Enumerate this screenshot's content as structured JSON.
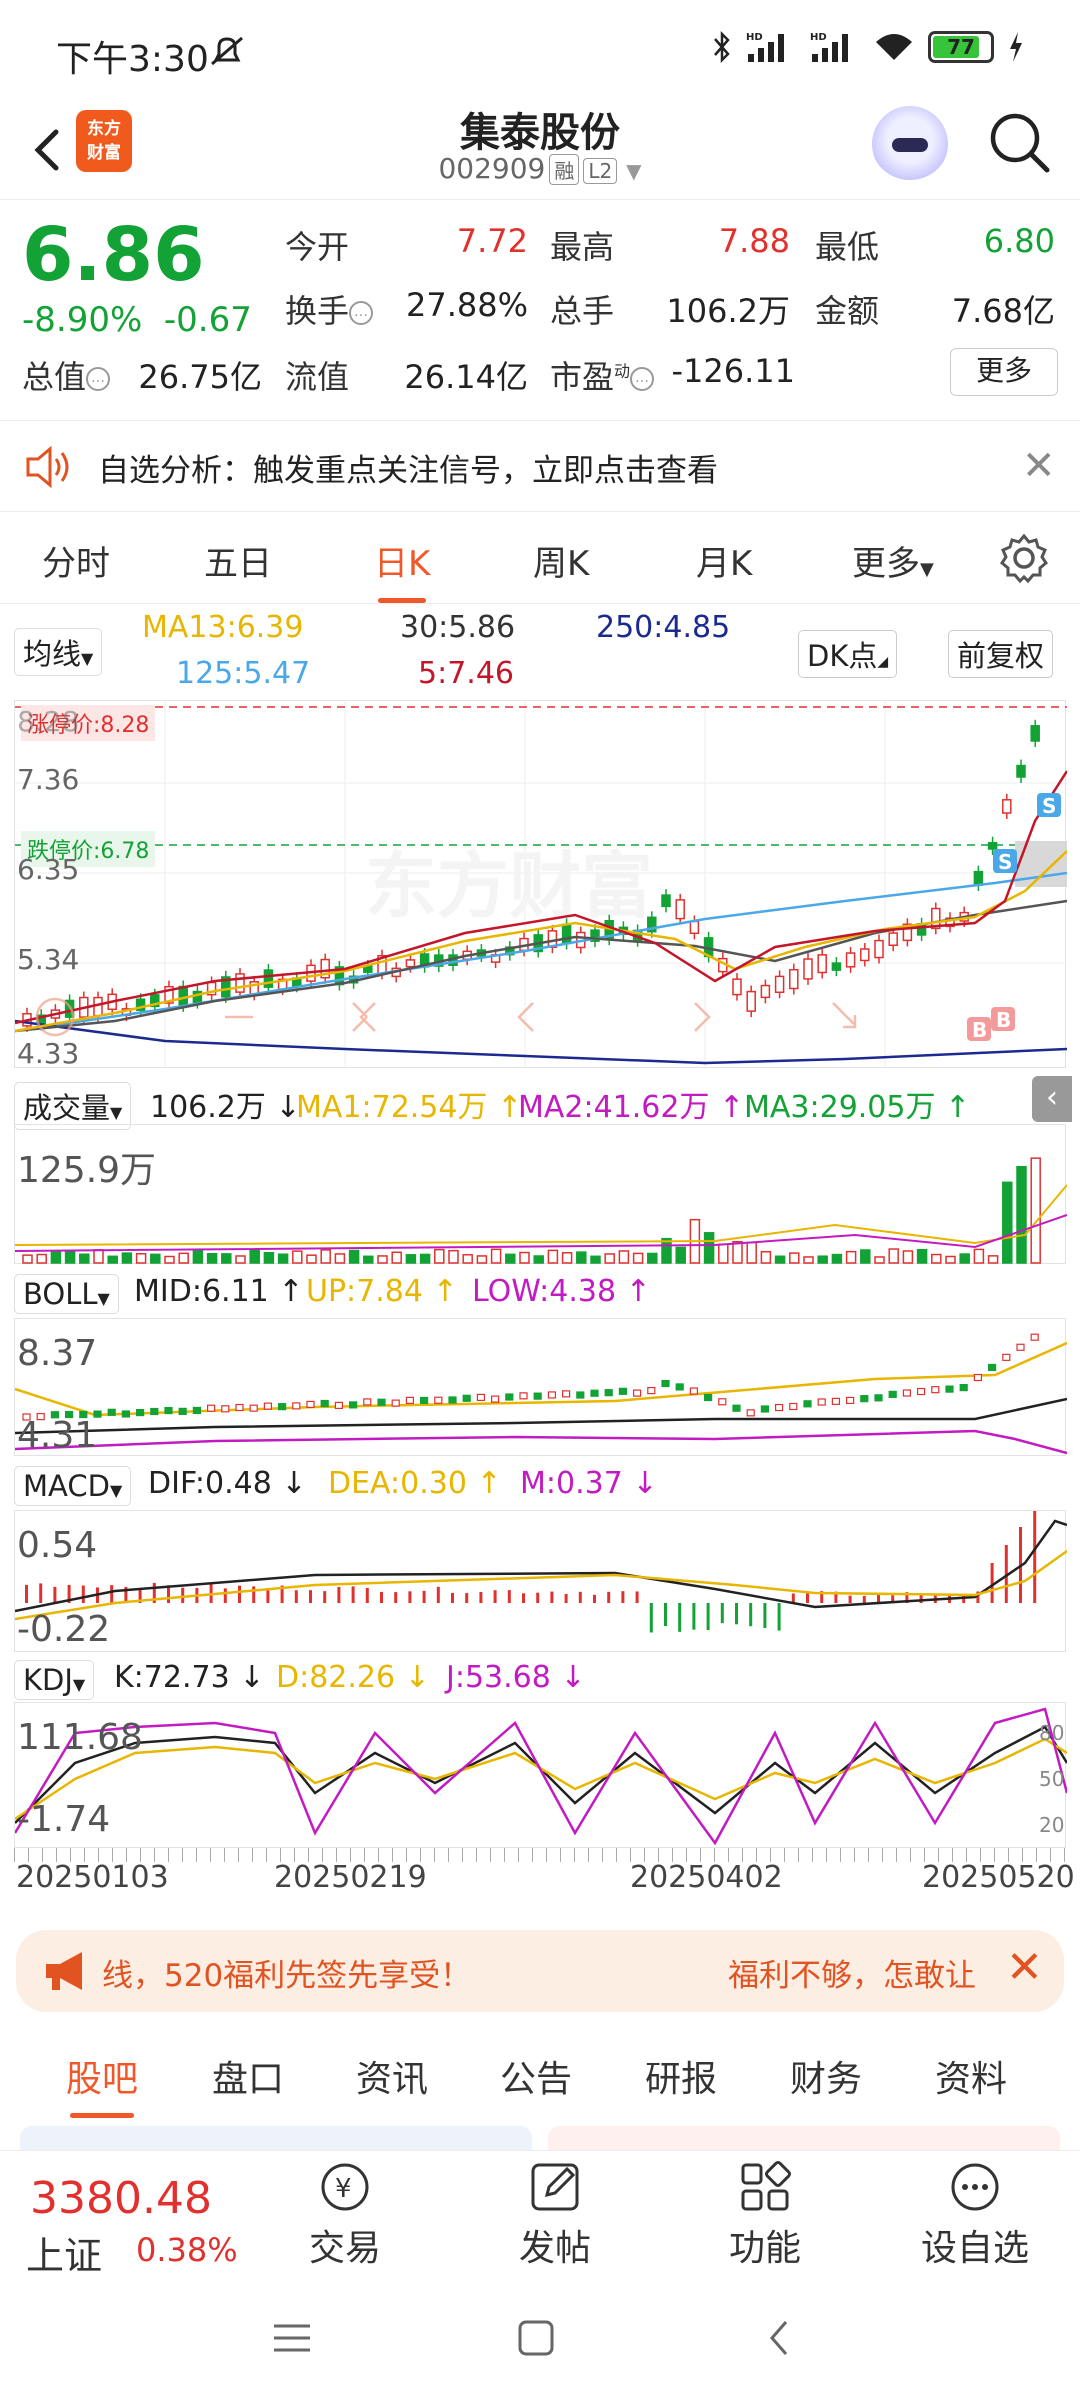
{
  "status": {
    "time": "下午3:30",
    "battery": "77",
    "hd1": "HD",
    "hd2": "HD"
  },
  "header": {
    "logo_line1": "东方",
    "logo_line2": "财富",
    "title": "集泰股份",
    "code": "002909",
    "tag1": "融",
    "tag2": "L2"
  },
  "quote": {
    "price": "6.86",
    "pct": "-8.90%",
    "chg": "-0.67",
    "open_label": "今开",
    "open": "7.72",
    "high_label": "最高",
    "high": "7.88",
    "low_label": "最低",
    "low": "6.80",
    "turnover_label": "换手",
    "turnover": "27.88%",
    "volume_label": "总手",
    "volume": "106.2万",
    "amount_label": "金额",
    "amount": "7.68亿",
    "mktcap_label": "总值",
    "mktcap": "26.75亿",
    "float_label": "流值",
    "float": "26.14亿",
    "pe_label": "市盈",
    "pe_sup": "动",
    "pe": "-126.11",
    "more": "更多"
  },
  "alert": {
    "text": "自选分析：触发重点关注信号，立即点击查看"
  },
  "period_tabs": [
    "分时",
    "五日",
    "日K",
    "周K",
    "月K",
    "更多"
  ],
  "ma": {
    "selector": "均线",
    "ma13": "MA13:6.39",
    "ma30": "30:5.86",
    "ma250": "250:4.85",
    "ma125": "125:5.47",
    "ma5": "5:7.46",
    "dk": "DK点",
    "adjust": "前复权"
  },
  "kline": {
    "limit_up": "涨停价:8.28",
    "limit_down": "跌停价:6.78",
    "y1": "8.28",
    "y2": "7.36",
    "y3": "6.35",
    "y4": "5.34",
    "y5": "4.33",
    "watermark": "东方财富",
    "s": "S",
    "b": "B"
  },
  "volume": {
    "selector": "成交量",
    "value": "106.2万",
    "ma1": "MA1:72.54万",
    "ma2": "MA2:41.62万",
    "ma3": "MA3:29.05万",
    "ymax": "125.9万"
  },
  "boll": {
    "selector": "BOLL",
    "mid": "MID:6.11",
    "up": "UP:7.84",
    "low": "LOW:4.38",
    "ymax": "8.37",
    "ymin": "4.31"
  },
  "macd": {
    "selector": "MACD",
    "dif": "DIF:0.48",
    "dea": "DEA:0.30",
    "m": "M:0.37",
    "ymax": "0.54",
    "ymin": "-0.22"
  },
  "kdj": {
    "selector": "KDJ",
    "k": "K:72.73",
    "d": "D:82.26",
    "j": "J:53.68",
    "ymax": "111.68",
    "ymin": "-1.74",
    "r80": "80",
    "r50": "50",
    "r20": "20"
  },
  "dates": [
    "20250103",
    "20250219",
    "20250402",
    "20250520"
  ],
  "banner": {
    "text1": "线，520福利先签先享受！",
    "text2": "福利不够，怎敢让"
  },
  "bottom_tabs": [
    "股吧",
    "盘口",
    "资讯",
    "公告",
    "研报",
    "财务",
    "资料"
  ],
  "index": {
    "value": "3380.48",
    "name": "上证",
    "pct": "0.38%"
  },
  "nav": [
    "交易",
    "发帖",
    "功能",
    "设自选"
  ],
  "colors": {
    "red": "#e0312e",
    "green": "#13a235",
    "accent": "#f0582a",
    "ma13": "#e8b600",
    "ma30": "#333333",
    "ma250": "#1b2a8f",
    "ma125": "#4aa8e8",
    "ma5": "#c4162a",
    "boll_up": "#e8b600",
    "boll_low": "#c21bc2"
  }
}
